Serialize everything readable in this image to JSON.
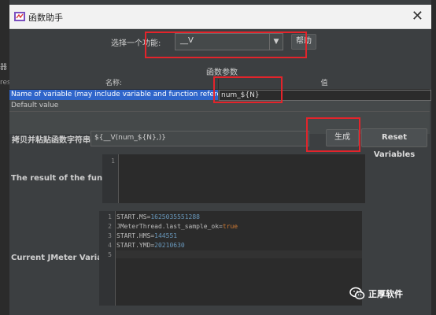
{
  "background": {
    "left_glyph_1": "器",
    "left_glyph_2": "res"
  },
  "dialog": {
    "title": "函数助手",
    "close_glyph": "✕",
    "function_label": "选择一个功能:",
    "function_value": "__V",
    "help_button": "帮助",
    "params_label": "函数参数",
    "table": {
      "headers": [
        "名称:",
        "值"
      ],
      "rows": [
        {
          "name": "Name of variable (may include variable and function references)",
          "value": "num_${N}"
        },
        {
          "name": "Default value",
          "value": ""
        }
      ]
    },
    "copy_label": "拷贝并粘贴函数字符串",
    "function_string": "${__V(num_${N},)}",
    "generate_button": "生成",
    "reset_button": "Reset Variables",
    "result_label": "The result of the function is",
    "result_lines": [
      "1"
    ],
    "vars_label": "Current JMeter Variables",
    "vars_lines": [
      {
        "num": "1",
        "key": "START.MS=",
        "val": "1625035551288"
      },
      {
        "num": "2",
        "key": "JMeterThread.last_sample_ok=",
        "val": "true"
      },
      {
        "num": "3",
        "key": "START.HMS=",
        "val": "144551"
      },
      {
        "num": "4",
        "key": "START.YMD=",
        "val": "20210630"
      },
      {
        "num": "5",
        "key": "",
        "val": ""
      }
    ]
  },
  "watermark": {
    "text": "正厚软件"
  },
  "colors": {
    "highlight": "#e3242b",
    "selection": "#2f65ca",
    "number": "#6897bb",
    "keyword": "#cc7832"
  }
}
